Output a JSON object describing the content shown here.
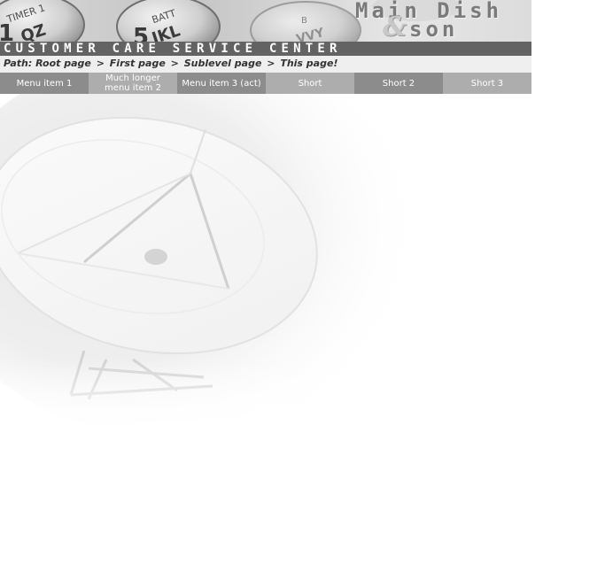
{
  "header": {
    "brand_line1": "Main Dish",
    "brand_ampersand": "&",
    "brand_line2": "son",
    "subtitle": "CUSTOMER CARE SERVICE CENTER",
    "photo_keys": [
      {
        "top": "TIMER 1",
        "big": "QZ"
      },
      {
        "top": "BATT",
        "big": "JKL"
      },
      {
        "top": "B",
        "big": "VVY"
      }
    ]
  },
  "breadcrumb": {
    "label": "Path:",
    "items": [
      "Root page",
      "First page",
      "Sublevel page",
      "This page!"
    ],
    "separator": ">"
  },
  "menu": {
    "items": [
      {
        "label": "Menu item 1",
        "active": false
      },
      {
        "label": "Much longer menu item 2",
        "active": false
      },
      {
        "label": "Menu item 3 (act)",
        "active": true
      },
      {
        "label": "Short",
        "active": false
      },
      {
        "label": "Short 2",
        "active": false
      },
      {
        "label": "Short 3",
        "active": false
      }
    ]
  },
  "colors": {
    "subtitle_bar": "#636363",
    "path_bar": "#efefef",
    "menu_dark": "#8c8c8c",
    "menu_light": "#adadad",
    "brand_text": "#7a7a7a"
  },
  "decor": {
    "background_image": "satellite-dish-illustration"
  }
}
